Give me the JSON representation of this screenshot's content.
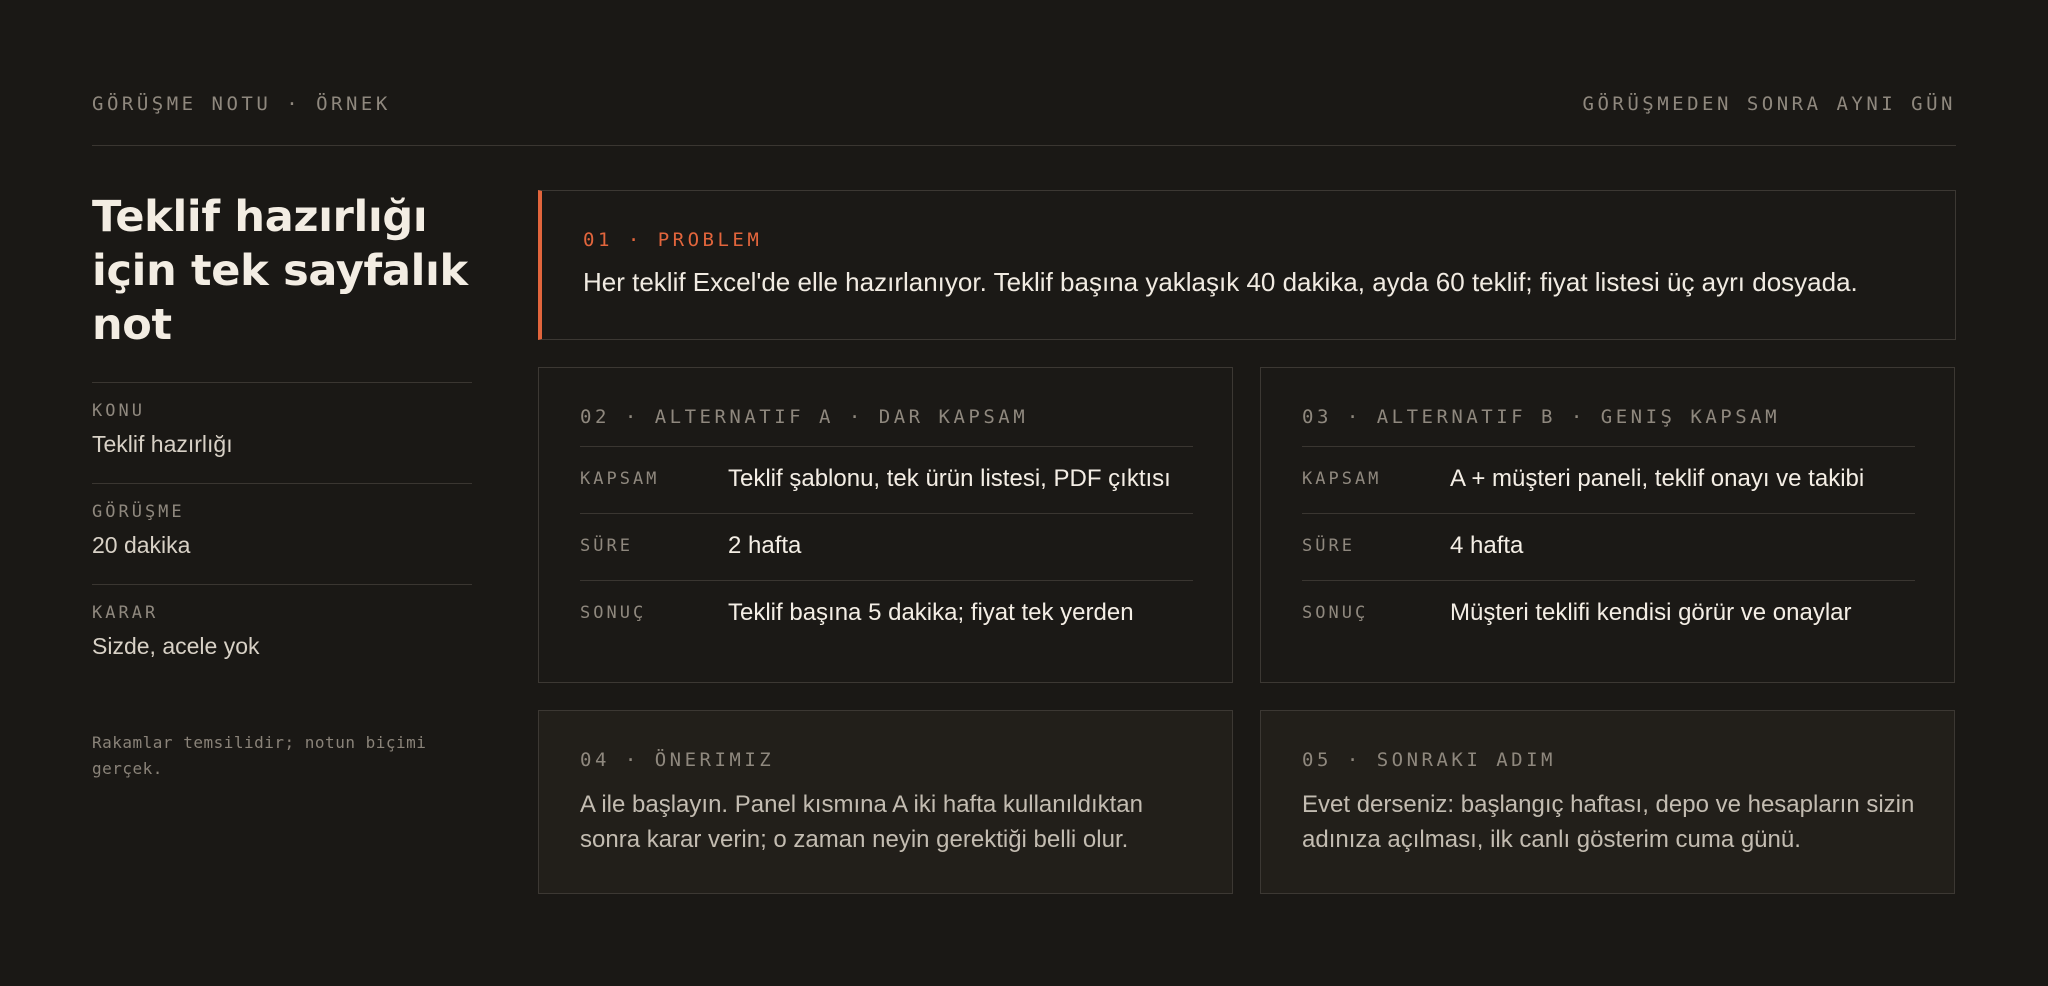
{
  "header": {
    "left": "GÖRÜŞME NOTU · ÖRNEK",
    "right": "GÖRÜŞMEDEN SONRA AYNI GÜN"
  },
  "sidebar": {
    "title": "Teklif hazırlığı için tek sayfalık not",
    "meta": [
      {
        "label": "KONU",
        "value": "Teklif hazırlığı"
      },
      {
        "label": "GÖRÜŞME",
        "value": "20 dakika"
      },
      {
        "label": "KARAR",
        "value": "Sizde, acele yok"
      }
    ],
    "footnote": "Rakamlar temsilidir; notun biçimi gerçek."
  },
  "problem": {
    "label": "01 · PROBLEM",
    "text": "Her teklif Excel'de elle hazırlanıyor. Teklif başına yaklaşık 40 dakika, ayda 60 teklif; fiyat listesi üç ayrı dosyada."
  },
  "alternatives": [
    {
      "label": "02 · ALTERNATIF A · DAR KAPSAM",
      "rows": [
        {
          "key": "KAPSAM",
          "value": "Teklif şablonu, tek ürün listesi, PDF çıktısı"
        },
        {
          "key": "SÜRE",
          "value": "2 hafta"
        },
        {
          "key": "SONUÇ",
          "value": "Teklif başına 5 dakika; fiyat tek yerden"
        }
      ]
    },
    {
      "label": "03 · ALTERNATIF B · GENIŞ KAPSAM",
      "rows": [
        {
          "key": "KAPSAM",
          "value": "A + müşteri paneli, teklif onayı ve takibi"
        },
        {
          "key": "SÜRE",
          "value": "4 hafta"
        },
        {
          "key": "SONUÇ",
          "value": "Müşteri teklifi kendisi görür ve onaylar"
        }
      ]
    }
  ],
  "notes": [
    {
      "label": "04 · ÖNERIMIZ",
      "text": "A ile başlayın. Panel kısmına A iki hafta kullanıldıktan sonra karar verin; o zaman neyin gerektiği belli olur."
    },
    {
      "label": "05 · SONRAKI ADIM",
      "text": "Evet derseniz: başlangıç haftası, depo ve hesapların sizin adınıza açılması, ilk canlı gösterim cuma günü."
    }
  ],
  "colors": {
    "background": "#1a1815",
    "accent": "#e2653c",
    "muted": "#8f887e"
  }
}
